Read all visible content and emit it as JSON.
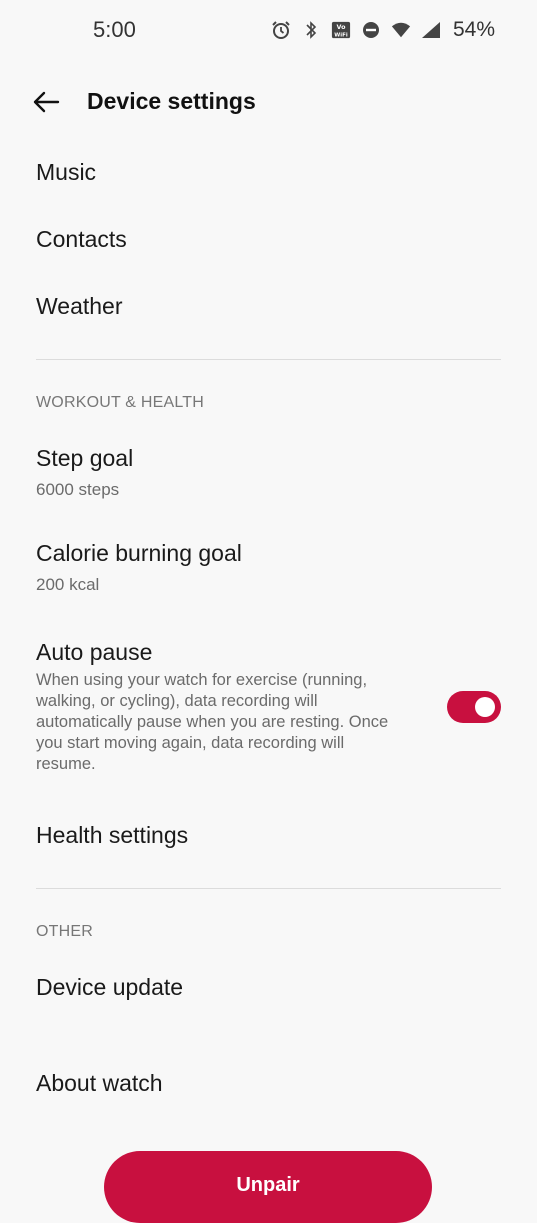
{
  "status_bar": {
    "time": "5:00",
    "battery": "54%",
    "icons": [
      "alarm-icon",
      "bluetooth-icon",
      "vowifi-icon",
      "do-not-disturb-icon",
      "wifi-icon",
      "signal-icon"
    ]
  },
  "header": {
    "title": "Device settings"
  },
  "items_top": [
    {
      "label": "Music"
    },
    {
      "label": "Contacts"
    },
    {
      "label": "Weather"
    }
  ],
  "workout": {
    "header": "WORKOUT & HEALTH",
    "step_goal": {
      "label": "Step goal",
      "value": "6000 steps"
    },
    "calorie_goal": {
      "label": "Calorie burning goal",
      "value": "200 kcal"
    },
    "auto_pause": {
      "label": "Auto pause",
      "description": "When using your watch for exercise (running, walking, or cycling), data recording will automatically pause when you are resting. Once you start moving again, data recording will resume.",
      "enabled": true
    },
    "health_settings": {
      "label": "Health settings"
    }
  },
  "other": {
    "header": "OTHER",
    "device_update": {
      "label": "Device update"
    },
    "about_watch": {
      "label": "About watch"
    }
  },
  "unpair_label": "Unpair",
  "colors": {
    "accent": "#c8103f",
    "background": "#f8f8f8"
  }
}
